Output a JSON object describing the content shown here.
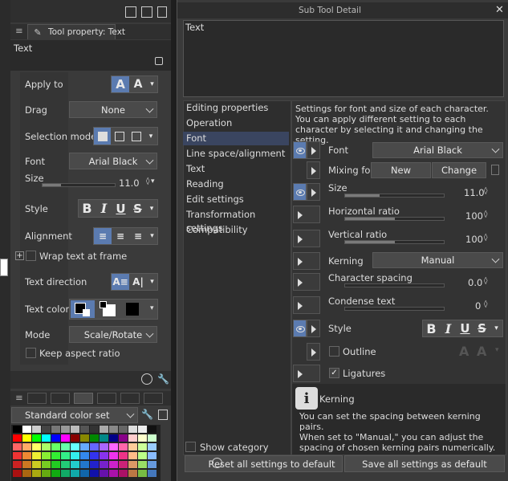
{
  "left_panel": {
    "tab_title": "Tool property: Text",
    "tool_name": "Text",
    "apply_to_label": "Apply to",
    "drag_label": "Drag",
    "drag_value": "None",
    "selection_mode_label": "Selection mode",
    "font_label": "Font",
    "font_value": "Arial Black",
    "size_label": "Size",
    "size_value": "11.0",
    "style_label": "Style",
    "alignment_label": "Alignment",
    "wrap_text_label": "Wrap text at frame",
    "text_direction_label": "Text direction",
    "text_color_label": "Text color",
    "mode_label": "Mode",
    "mode_value": "Scale/Rotate",
    "keep_aspect_label": "Keep aspect ratio",
    "color_set_value": "Standard color set"
  },
  "dialog": {
    "title": "Sub Tool Detail",
    "preview_text": "Text",
    "categories": [
      {
        "label": "Editing properties",
        "selected": false
      },
      {
        "label": "Operation",
        "selected": false
      },
      {
        "label": "Font",
        "selected": true
      },
      {
        "label": "Line space/alignment",
        "selected": false
      },
      {
        "label": "Text",
        "selected": false
      },
      {
        "label": "Reading",
        "selected": false
      },
      {
        "label": "Edit settings",
        "selected": false
      },
      {
        "label": "Transformation settings",
        "selected": false
      },
      {
        "label": "Compatibility",
        "selected": false
      }
    ],
    "description": "Settings for font and size of each character.\nYou can apply different setting to each character by selecting it and changing the setting.",
    "font_label": "Font",
    "font_value": "Arial Black",
    "mixing_font_label": "Mixing font",
    "new_label": "New",
    "change_label": "Change",
    "size_label": "Size",
    "size_value": "11.0",
    "hratio_label": "Horizontal ratio",
    "hratio_value": "100",
    "vratio_label": "Vertical ratio",
    "vratio_value": "100",
    "kerning_label": "Kerning",
    "kerning_value": "Manual",
    "char_spacing_label": "Character spacing",
    "char_spacing_value": "0.0",
    "condense_label": "Condense text",
    "condense_value": "0",
    "style_label": "Style",
    "outline_label": "Outline",
    "ligatures_label": "Ligatures",
    "help_title": "Kerning",
    "help_text": "You can set the spacing between kerning pairs.\nWhen set to \"Manual,\" you can adjust the spacing of chosen kerning pairs numerically.\n\"Matrix\" will automatically adjust the spacing of specific",
    "show_category_label": "Show category",
    "reset_label": "Reset all settings to default",
    "save_label": "Save all settings as default"
  }
}
